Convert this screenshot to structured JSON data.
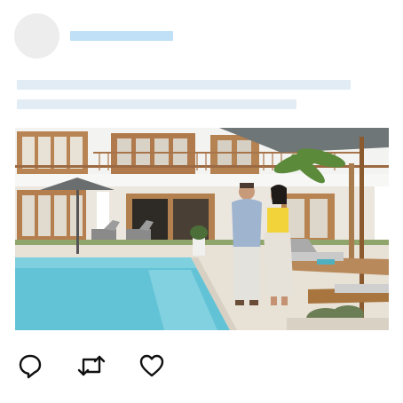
{
  "post": {
    "avatar": "avatar-placeholder",
    "author_placeholder": "skeleton-bar",
    "text_placeholder_lines": 2,
    "image": {
      "subject": "couple-walking-by-pool-villa"
    }
  },
  "actions": [
    {
      "icon": "reply-icon"
    },
    {
      "icon": "retweet-icon"
    },
    {
      "icon": "heart-icon"
    }
  ],
  "colors": {
    "skeleton_name": "#bfe0f6",
    "skeleton_text": "#e2ecf4",
    "avatar": "#ededed",
    "icon_stroke": "#111111"
  }
}
